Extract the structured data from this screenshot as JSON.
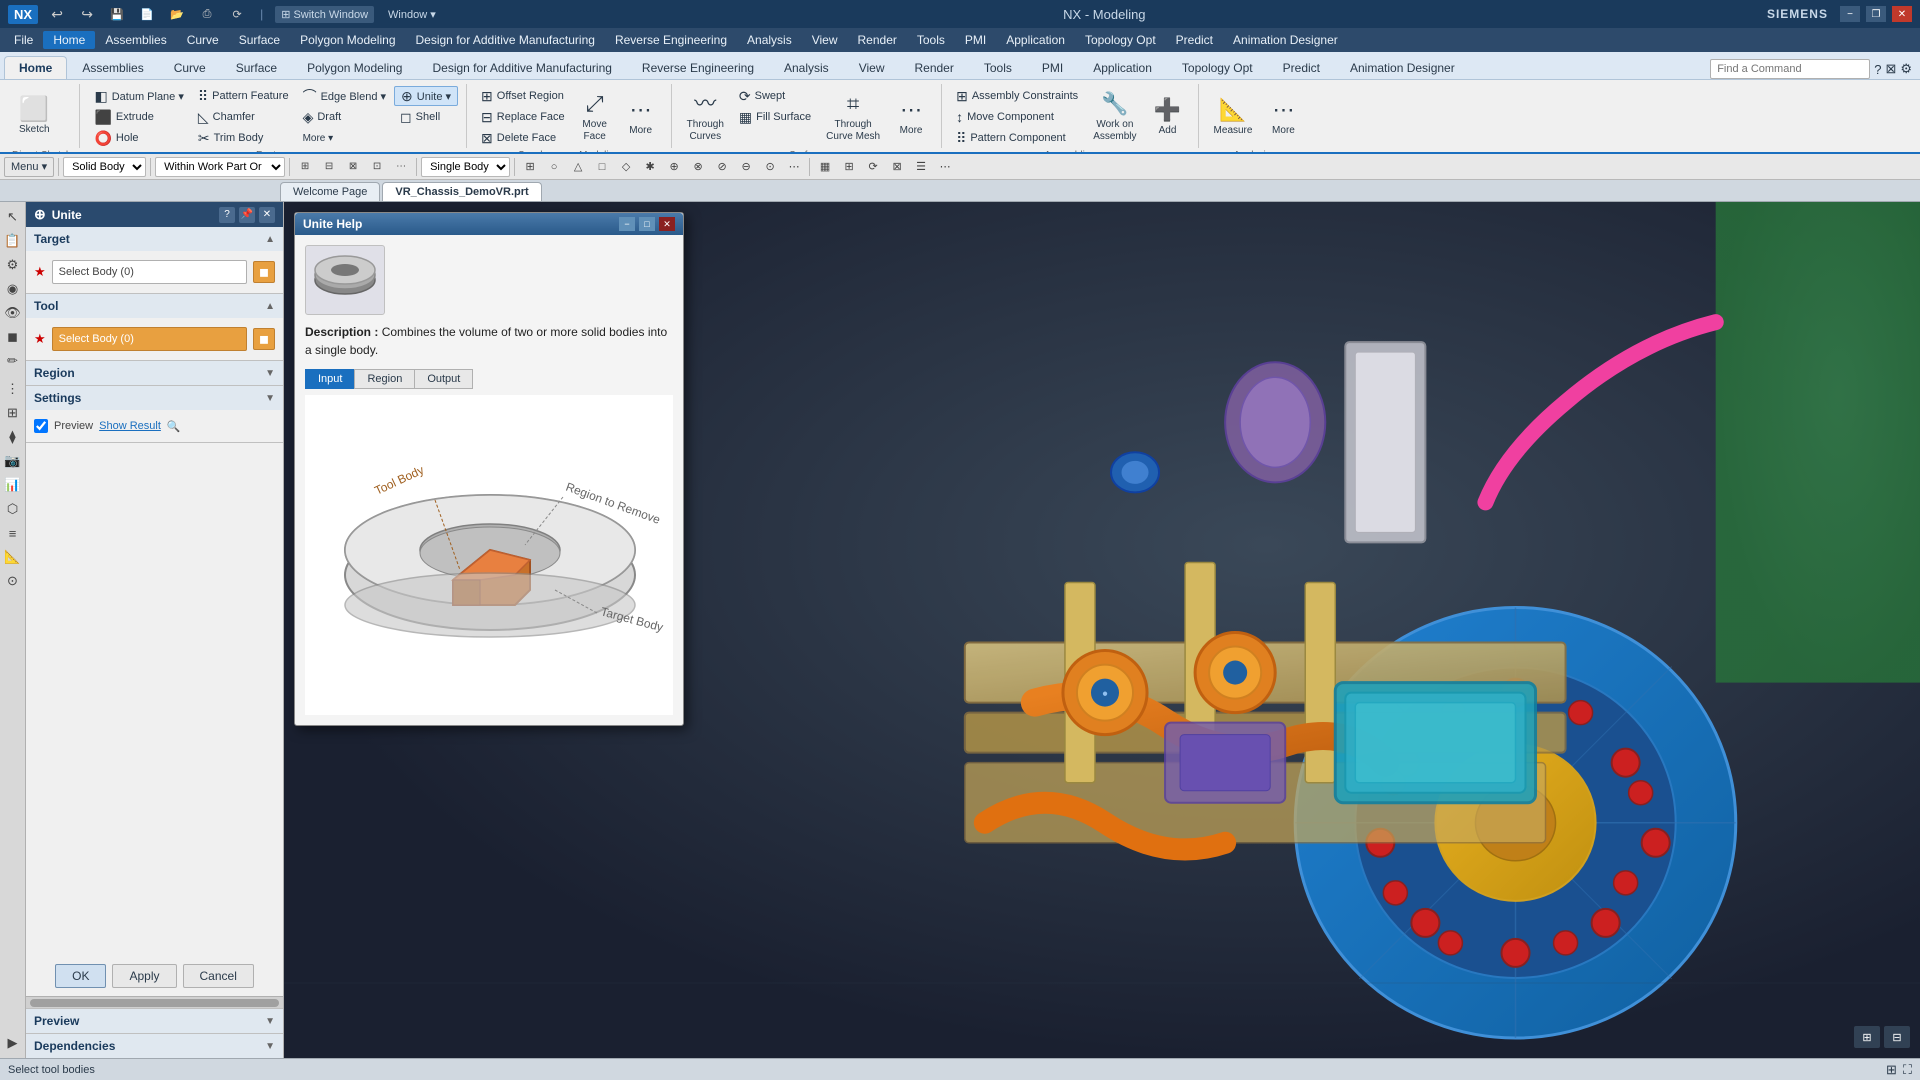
{
  "app": {
    "title": "NX - Modeling",
    "logo": "NX",
    "company": "SIEMENS"
  },
  "titlebar": {
    "title": "NX - Modeling",
    "minimize": "−",
    "maximize": "□",
    "close": "✕",
    "restore": "❐"
  },
  "menu": {
    "items": [
      "File",
      "Home",
      "Assemblies",
      "Curve",
      "Surface",
      "Polygon Modeling",
      "Design for Additive Manufacturing",
      "Reverse Engineering",
      "Analysis",
      "View",
      "Render",
      "Tools",
      "PMI",
      "Application",
      "Topology Opt",
      "Predict",
      "Animation Designer"
    ]
  },
  "ribbon": {
    "active_tab": "Home",
    "groups": [
      {
        "name": "Direct Sketch",
        "buttons": [
          "Sketch"
        ]
      },
      {
        "name": "Feature",
        "buttons": [
          "Datum Plane",
          "Extrude",
          "Hole",
          "Pattern Feature",
          "Chamfer",
          "Trim Body",
          "Edge Blend",
          "Draft",
          "Unite",
          "Shell",
          "More",
          "More"
        ]
      },
      {
        "name": "Synchronous Modeling",
        "buttons": [
          "Offset Region",
          "Replace Face",
          "Delete Face",
          "Move Face",
          "More"
        ]
      },
      {
        "name": "Surface",
        "buttons": [
          "Through Curves",
          "Swept",
          "Fill Surface",
          "Through Curve Mesh",
          "More"
        ]
      },
      {
        "name": "Assemblies",
        "buttons": [
          "Assembly Constraints",
          "Work on Assembly",
          "Add",
          "Move Component",
          "Pattern Component"
        ]
      },
      {
        "name": "Analysis",
        "buttons": [
          "Measure",
          "More"
        ]
      }
    ]
  },
  "toolbar": {
    "dropdown_solid_body": "Solid Body",
    "dropdown_within_work_part": "Within Work Part Or",
    "dropdown_single_body": "Single Body"
  },
  "tabs": {
    "welcome": "Welcome Page",
    "active_doc": "VR_Chassis_DemoVR.prt"
  },
  "side_panel": {
    "title": "Unite",
    "sections": [
      {
        "name": "Target",
        "expanded": true,
        "fields": [
          {
            "label": "Select Body (0)",
            "active": false
          }
        ]
      },
      {
        "name": "Tool",
        "expanded": true,
        "fields": [
          {
            "label": "Select Body (0)",
            "active": true
          }
        ]
      },
      {
        "name": "Region",
        "expanded": false
      },
      {
        "name": "Settings",
        "expanded": false
      }
    ],
    "preview_label": "Preview",
    "show_result_label": "Show Result",
    "buttons": [
      "OK",
      "Apply",
      "Cancel"
    ]
  },
  "unite_help": {
    "title": "Unite Help",
    "description_label": "Description :",
    "description_text": "Combines the volume of two or more solid bodies into a single body.",
    "tabs": [
      "Input",
      "Region",
      "Output"
    ],
    "active_tab": "Input",
    "image_labels": {
      "tool_body": "Tool Body",
      "region_to_remove": "Region to Remove",
      "target_body": "Target Body"
    }
  },
  "status_bar": {
    "message": "Select tool bodies"
  },
  "icons": {
    "undo": "↩",
    "redo": "↪",
    "save": "💾",
    "open": "📂",
    "new": "📄",
    "zoom_in": "🔍",
    "question": "?",
    "settings": "⚙",
    "search": "🔍",
    "close": "✕",
    "minimize": "−",
    "maximize": "□",
    "pin": "📌",
    "up": "▲",
    "down": "▼",
    "left": "◀",
    "right": "▶",
    "chevron_down": "▼",
    "chevron_right": "▶",
    "expand": "⊞",
    "collapse": "⊟"
  }
}
